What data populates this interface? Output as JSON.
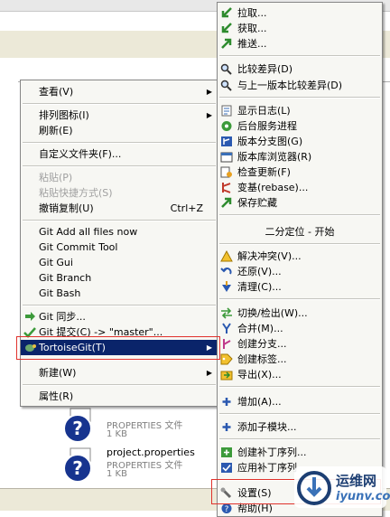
{
  "background_files": [
    {
      "name": "",
      "type": "PROPERTIES 文件",
      "size": "1 KB"
    },
    {
      "name": "project.properties",
      "type": "PROPERTIES 文件",
      "size": "1 KB"
    }
  ],
  "context_menu": {
    "items": [
      {
        "label": "查看(V)"
      },
      {
        "label": "排列图标(I)"
      },
      {
        "label": "刷新(E)"
      },
      {
        "label": "自定义文件夹(F)..."
      },
      {
        "label": "粘贴(P)"
      },
      {
        "label": "粘贴快捷方式(S)"
      },
      {
        "label": "撤销复制(U)",
        "shortcut": "Ctrl+Z"
      },
      {
        "label": "Git Add all files now"
      },
      {
        "label": "Git Commit Tool"
      },
      {
        "label": "Git Gui"
      },
      {
        "label": "Git Branch"
      },
      {
        "label": "Git Bash"
      },
      {
        "label": "Git 同步..."
      },
      {
        "label": "Git 提交(C) -> \"master\"..."
      },
      {
        "label": "TortoiseGit(T)"
      },
      {
        "label": "新建(W)"
      },
      {
        "label": "属性(R)"
      }
    ]
  },
  "tortoisegit_submenu": {
    "items": [
      {
        "label": "拉取...",
        "icon": "pull-icon"
      },
      {
        "label": "获取...",
        "icon": "fetch-icon"
      },
      {
        "label": "推送...",
        "icon": "push-icon"
      },
      {
        "label": "比较差异(D)",
        "icon": "diff-icon"
      },
      {
        "label": "与上一版本比较差异(D)",
        "icon": "diff-previous-icon"
      },
      {
        "label": "显示日志(L)",
        "icon": "log-icon"
      },
      {
        "label": "后台服务进程",
        "icon": "daemon-icon"
      },
      {
        "label": "版本分支图(G)",
        "icon": "revision-graph-icon"
      },
      {
        "label": "版本库浏览器(R)",
        "icon": "repo-browser-icon"
      },
      {
        "label": "检查更新(F)",
        "icon": "check-modifications-icon"
      },
      {
        "label": "变基(rebase)...",
        "icon": "rebase-icon"
      },
      {
        "label": "保存贮藏",
        "icon": "stash-icon"
      },
      {
        "label": "二分定位 - 开始"
      },
      {
        "label": "解决冲突(V)...",
        "icon": "resolve-icon"
      },
      {
        "label": "还原(V)...",
        "icon": "revert-icon"
      },
      {
        "label": "清理(C)...",
        "icon": "cleanup-icon"
      },
      {
        "label": "切换/检出(W)...",
        "icon": "switch-icon"
      },
      {
        "label": "合并(M)...",
        "icon": "merge-icon"
      },
      {
        "label": "创建分支...",
        "icon": "branch-icon"
      },
      {
        "label": "创建标签...",
        "icon": "tag-icon"
      },
      {
        "label": "导出(X)...",
        "icon": "export-icon"
      },
      {
        "label": "增加(A)...",
        "icon": "add-icon"
      },
      {
        "label": "添加子模块...",
        "icon": "submodule-icon"
      },
      {
        "label": "创建补丁序列...",
        "icon": "create-patch-icon"
      },
      {
        "label": "应用补丁序列",
        "icon": "apply-patch-icon"
      },
      {
        "label": "设置(S)",
        "icon": "settings-icon"
      },
      {
        "label": "帮助(H)",
        "icon": "help-icon"
      }
    ]
  },
  "watermark": {
    "text_cn": "运维网",
    "text_en": "iyunv.com"
  },
  "colors": {
    "highlight": "#0a246a",
    "annotation": "#e0322c",
    "menu_bg": "#f7f7f3"
  }
}
